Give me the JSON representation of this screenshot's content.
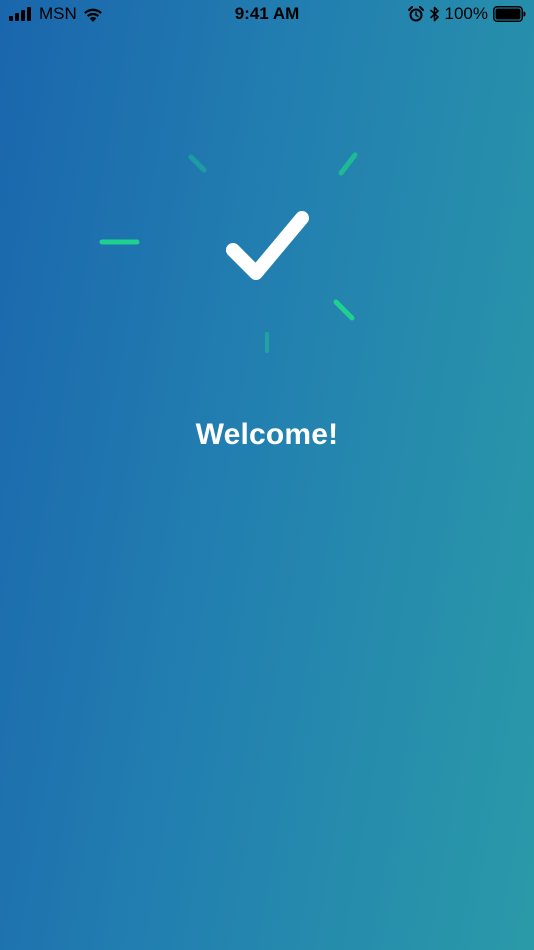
{
  "status_bar": {
    "carrier": "MSN",
    "time": "9:41 AM",
    "battery_percent": "100%",
    "battery_level": 1.0,
    "signal_bars": 4,
    "icons": [
      "signal-icon",
      "wifi-icon",
      "alarm-icon",
      "bluetooth-icon",
      "battery-icon"
    ]
  },
  "main": {
    "welcome_text": "Welcome!",
    "icon": "checkmark-icon"
  },
  "colors": {
    "gradient_start": "#1a66ad",
    "gradient_end": "#2a9aa8",
    "accent_ray": "#1fd18f",
    "check": "#ffffff",
    "status_text": "#000000"
  }
}
